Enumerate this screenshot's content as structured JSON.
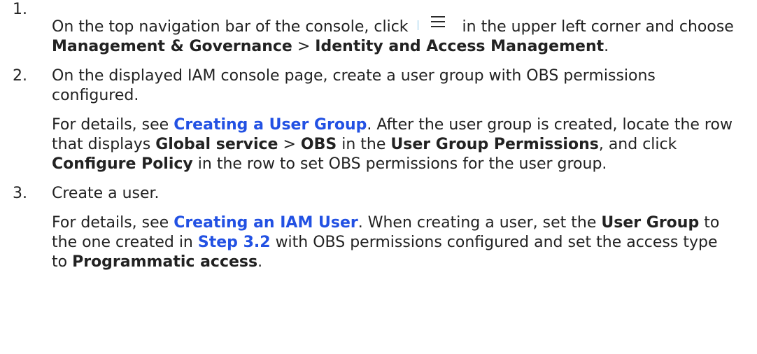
{
  "steps": [
    {
      "number": "1.",
      "text_1": "On the top navigation bar of the console, click",
      "icon": "hamburger-menu-icon",
      "text_2": "in the upper left corner and choose",
      "menu_1": "Management & Governance",
      "separator": ">",
      "menu_2": "Identity and Access Management",
      "end": "."
    },
    {
      "number": "2.",
      "text": "On the displayed IAM console page, create a user group with OBS permissions configured.",
      "detail": {
        "prefix": "For details, see",
        "link": "Creating a User Group",
        "text_1": ". After the user group is created, locate the row that displays",
        "bold_1": "Global service",
        "separator": ">",
        "bold_2": "OBS",
        "text_2": "in the",
        "bold_3": "User Group Permissions",
        "text_3": ", and click",
        "bold_4": "Configure Policy",
        "text_4": "in the row to set OBS permissions for the user group."
      }
    },
    {
      "number": "3.",
      "text": "Create a user.",
      "detail": {
        "prefix": "For details, see",
        "link": "Creating an IAM User",
        "text_1": ". When creating a user, set the",
        "bold_1": "User Group",
        "text_2": "to the one created in",
        "link_2": "Step 3.2",
        "text_3": "with OBS permissions configured and set the access type to",
        "bold_2": "Programmatic access",
        "end": "."
      }
    }
  ]
}
